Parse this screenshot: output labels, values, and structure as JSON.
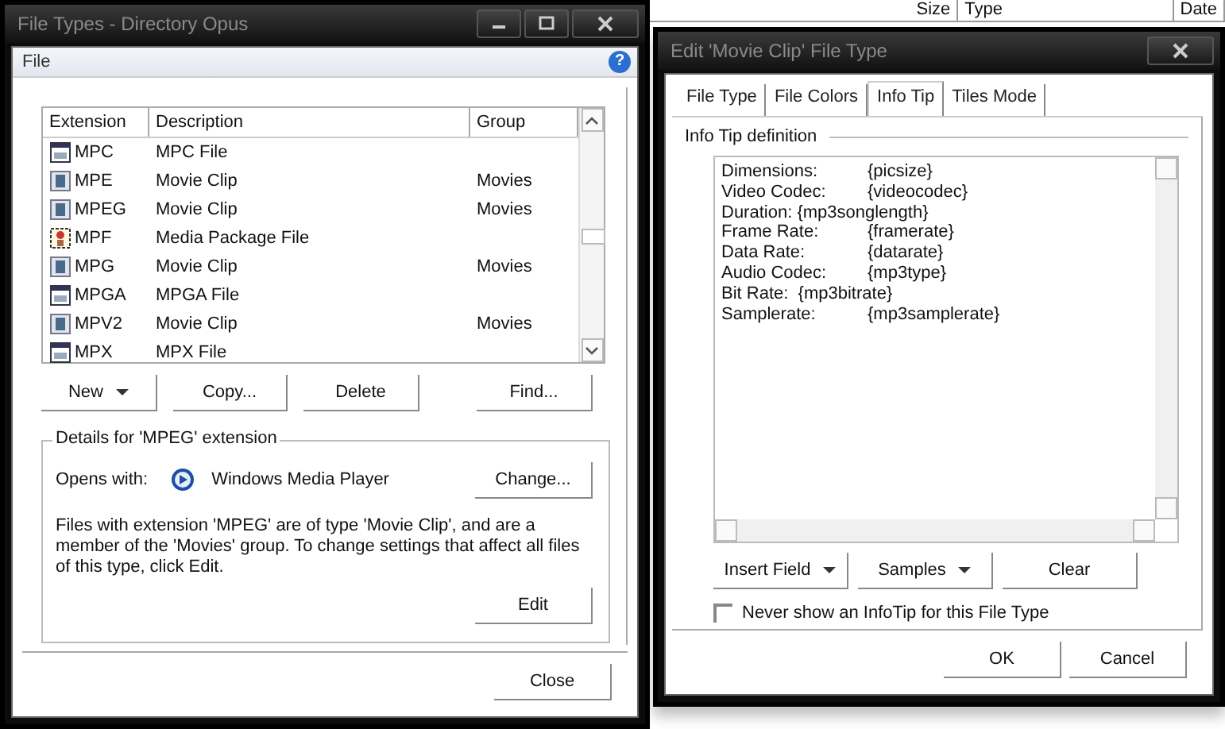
{
  "background": {
    "column_headers": [
      "Size",
      "Type",
      "Date"
    ]
  },
  "file_types_window": {
    "title": "File Types - Directory Opus",
    "menu": [
      "File"
    ],
    "help_button": "?",
    "columns": [
      "Extension",
      "Description",
      "Group"
    ],
    "rows": [
      {
        "extension": "MPC",
        "description": "MPC File",
        "kind": "generic"
      },
      {
        "extension": "MPE",
        "description": "Movie Clip",
        "group": "Movies",
        "kind": "movie"
      },
      {
        "extension": "MPEG",
        "description": "Movie Clip",
        "group": "Movies",
        "kind": "movie"
      },
      {
        "extension": "MPF",
        "description": "Media Package File",
        "kind": "package"
      },
      {
        "extension": "MPG",
        "description": "Movie Clip",
        "group": "Movies",
        "kind": "movie"
      },
      {
        "extension": "MPGA",
        "description": "MPGA File",
        "kind": "generic"
      },
      {
        "extension": "MPV2",
        "description": "Movie Clip",
        "group": "Movies",
        "kind": "movie"
      },
      {
        "extension": "MPX",
        "description": "MPX File",
        "kind": "generic"
      }
    ],
    "buttons": [
      {
        "label": "New",
        "dropdown": true
      },
      {
        "label": "Copy...",
        "dropdown": false
      },
      {
        "label": "Delete",
        "dropdown": false
      },
      {
        "label": "Find...",
        "dropdown": false
      }
    ],
    "details": {
      "title": "Details for 'MPEG' extension",
      "opens_with_label": "Opens with:",
      "application": "Windows Media Player",
      "change_button": "Change...",
      "description": "Files with extension 'MPEG' are of type 'Movie Clip', and are a member of the 'Movies' group. To change settings that affect all files of this type, click Edit.",
      "edit_button": "Edit"
    },
    "close_button": "Close"
  },
  "edit_window": {
    "title": "Edit 'Movie Clip' File Type",
    "tabs": [
      {
        "label": "File Type",
        "selected": false
      },
      {
        "label": "File Colors",
        "selected": false
      },
      {
        "label": "Info Tip",
        "selected": true
      },
      {
        "label": "Tiles Mode",
        "selected": false
      }
    ],
    "group_label": "Info Tip definition",
    "definition_lines": [
      "Dimensions:\t{picsize}",
      "Video Codec:\t{videocodec}",
      "Duration: {mp3songlength}",
      "Frame Rate:\t{framerate}",
      "Data Rate:\t{datarate}",
      "Audio Codec:\t{mp3type}",
      "Bit Rate:  {mp3bitrate}",
      "Samplerate:\t{mp3samplerate}"
    ],
    "buttons": [
      {
        "label": "Insert Field",
        "dropdown": true
      },
      {
        "label": "Samples",
        "dropdown": true
      },
      {
        "label": "Clear",
        "dropdown": false
      }
    ],
    "checkbox": {
      "label": "Never show an InfoTip for this File Type",
      "checked": false
    },
    "ok_button": "OK",
    "cancel_button": "Cancel"
  }
}
